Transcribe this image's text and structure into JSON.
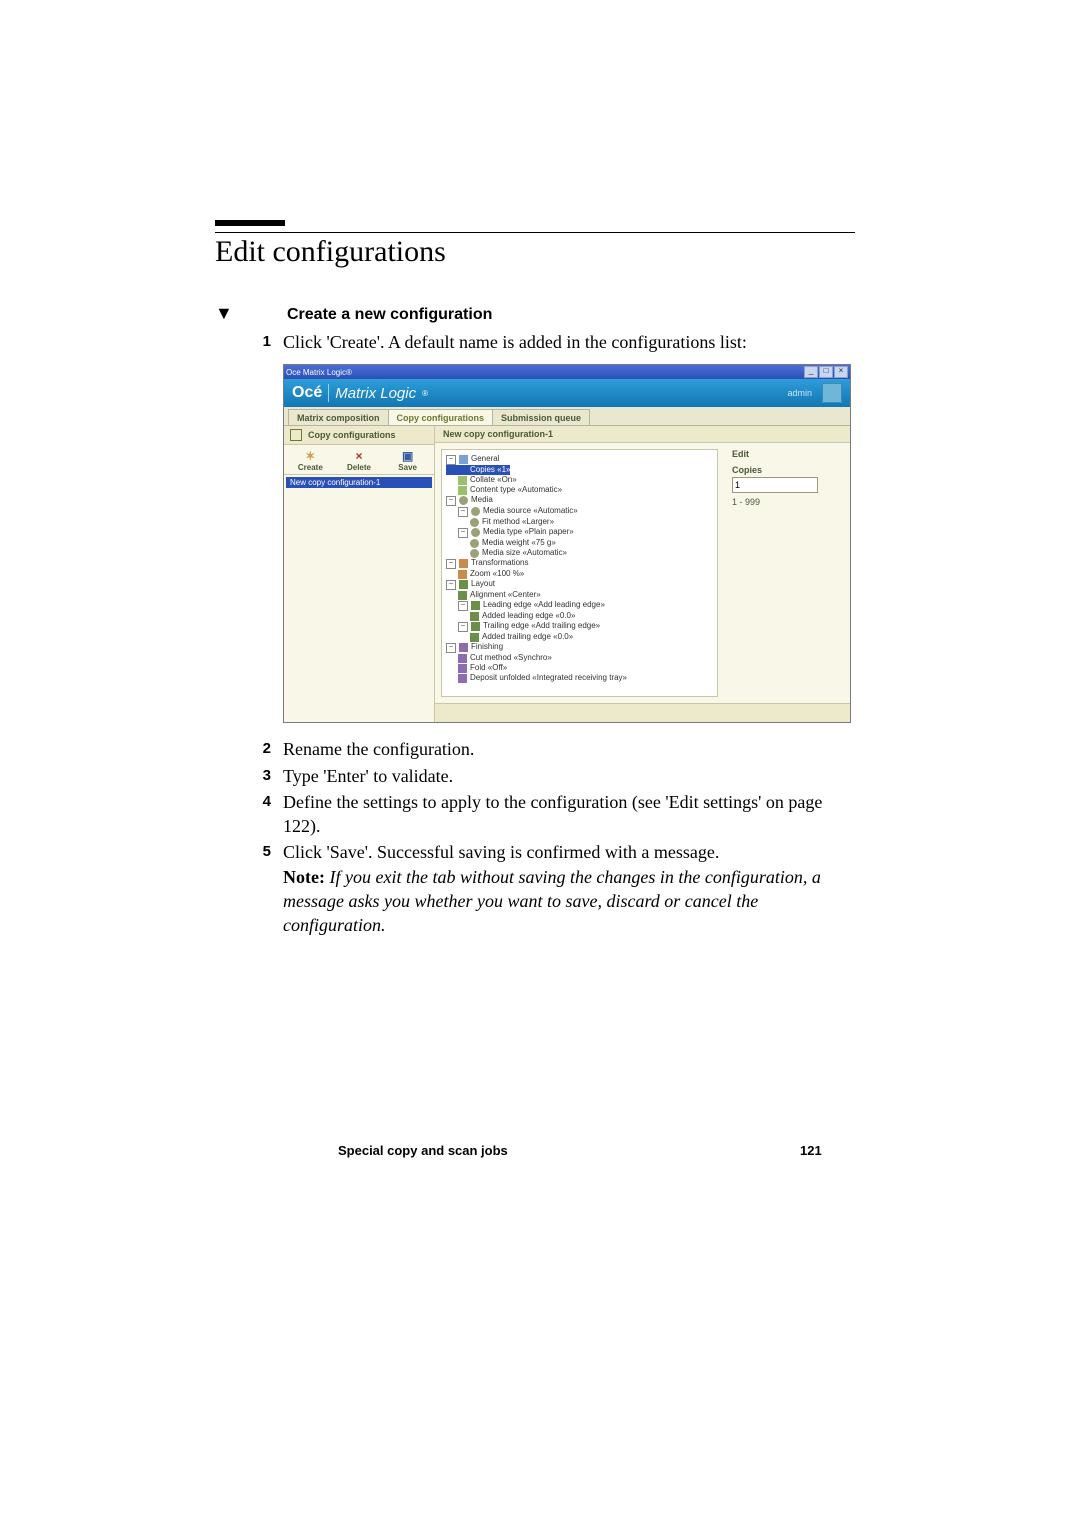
{
  "doc": {
    "section_title": "Edit configurations",
    "subhead": "Create a new configuration",
    "steps": {
      "s1": "Click 'Create'. A default name is added in the configurations list:",
      "s2": "Rename the configuration.",
      "s3": "Type 'Enter' to validate.",
      "s4": "Define the settings to apply to the configuration (see 'Edit settings' on page 122).",
      "s5": "Click 'Save'. Successful saving is confirmed with a message.",
      "note_label": "Note:",
      "note_body": "If you exit the tab without saving the changes in the configuration, a message asks you whether you want to save, discard or cancel the configuration."
    },
    "footer_text": "Special copy and scan jobs",
    "footer_page": "121"
  },
  "app": {
    "window_title": "Oce Matrix Logic®",
    "brand_oce": "Océ",
    "brand_product": "Matrix Logic",
    "brand_reg": "®",
    "brand_user": "admin",
    "tabs": {
      "t1": "Matrix composition",
      "t2": "Copy configurations",
      "t3": "Submission queue"
    },
    "side": {
      "title": "Copy configurations",
      "tools": {
        "create": "Create",
        "delete": "Delete",
        "save": "Save"
      },
      "list_item": "New copy configuration-1"
    },
    "main": {
      "title": "New copy configuration-1",
      "edit": {
        "title": "Edit",
        "label": "Copies",
        "value": "1",
        "range": "1 - 999"
      }
    },
    "tree": {
      "general": "General",
      "copies": "Copies «1»",
      "collate": "Collate «On»",
      "content_type": "Content type «Automatic»",
      "media": "Media",
      "media_source": "Media source «Automatic»",
      "fit_method": "Fit method «Larger»",
      "media_type": "Media type «Plain paper»",
      "media_weight": "Media weight «75 g»",
      "media_size": "Media size «Automatic»",
      "transformations": "Transformations",
      "zoom": "Zoom «100 %»",
      "layout": "Layout",
      "alignment": "Alignment «Center»",
      "leading_edge": "Leading edge «Add leading edge»",
      "added_leading": "Added leading edge «0.0»",
      "trailing_edge": "Trailing edge «Add trailing edge»",
      "added_trailing": "Added trailing edge «0.0»",
      "finishing": "Finishing",
      "cut_method": "Cut method «Synchro»",
      "fold": "Fold «Off»",
      "deposit": "Deposit unfolded «Integrated receiving tray»"
    }
  }
}
